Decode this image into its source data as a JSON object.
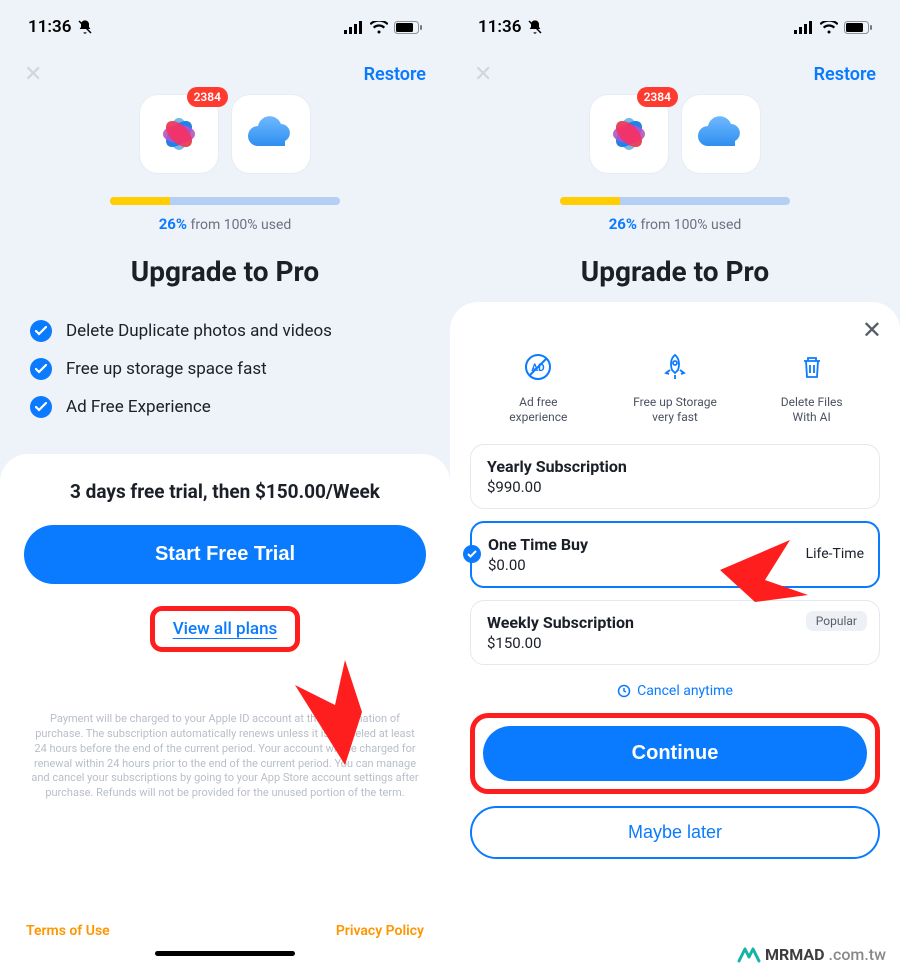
{
  "status": {
    "time": "11:36"
  },
  "topnav": {
    "restore": "Restore"
  },
  "hero": {
    "badge": "2384"
  },
  "progress": {
    "percent_text": "26%",
    "suffix": " from 100% used"
  },
  "title": "Upgrade to Pro",
  "features": [
    "Delete Duplicate photos and videos",
    "Free up storage space fast",
    "Ad Free Experience"
  ],
  "screen1": {
    "trial_line": "3 days free trial, then $150.00/Week",
    "start_btn": "Start Free Trial",
    "view_plans": "View all plans",
    "fine_print": "Payment will be charged to your Apple ID account at the confirmation of purchase. The subscription automatically renews unless it is canceled at least 24 hours before the end of the current period. Your account will be charged for renewal within 24 hours prior to the end of the current period. You can manage and cancel your subscriptions by going to your App Store account settings after purchase. Refunds will not be provided for the unused portion of the term.",
    "terms": "Terms of Use",
    "privacy": "Privacy Policy"
  },
  "screen2": {
    "benefits": [
      {
        "line1": "Ad free",
        "line2": "experience"
      },
      {
        "line1": "Free up Storage",
        "line2": "very fast"
      },
      {
        "line1": "Delete Files",
        "line2": "With AI"
      }
    ],
    "plans": [
      {
        "name": "Yearly Subscription",
        "price": "$990.00"
      },
      {
        "name": "One Time Buy",
        "price": "$0.00",
        "right": "Life-Time",
        "selected": true
      },
      {
        "name": "Weekly Subscription",
        "price": "$150.00",
        "tag": "Popular"
      }
    ],
    "cancel": "Cancel anytime",
    "continue": "Continue",
    "maybe": "Maybe later"
  },
  "watermark": {
    "brand": "MRMAD",
    "domain": ".com.tw"
  }
}
